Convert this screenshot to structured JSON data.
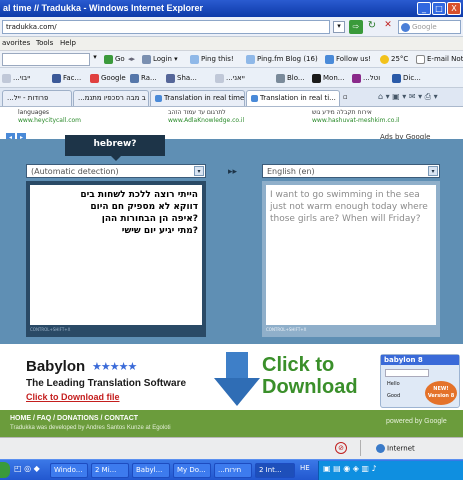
{
  "window": {
    "title": "al time // Tradukka - Windows Internet Explorer",
    "min": "_",
    "max": "□",
    "close": "X"
  },
  "address": {
    "url": "tradukka.com/",
    "search_placeholder": "Google"
  },
  "menu": [
    "avorites",
    "Tools",
    "Help"
  ],
  "google_toolbar": {
    "go": "Go",
    "login": "Login",
    "ping_this": "Ping this!",
    "ping_blog": "Ping.fm Blog (16)",
    "follow": "Follow us!",
    "weather": "25°C",
    "email": "E-mail Notifier"
  },
  "favorites": [
    "...ייבוי",
    "Fac...",
    "Google",
    "Ra...",
    "Sha...",
    "...ייאני",
    "Blo...",
    "Mon...",
    "...וטל",
    "Dic..."
  ],
  "tabs": [
    "...פרודות - ייל",
    "...מעמים ב מבה רסכפיו מתנמ",
    "Translation in real time //...",
    "Translation in real ti..."
  ],
  "ads": [
    {
      "line": "languages",
      "url": "www.heycitycall.com"
    },
    {
      "line": "לתרגום עד עמוד הזהב",
      "url": "www.AdlaKnowledge.co.il"
    },
    {
      "line": "אירוח תקבלה מידע גוש",
      "url": "www.hashuvat-meshkim.co.il"
    }
  ],
  "ads_by": "Ads by Google",
  "translator": {
    "detected_label": "hebrew?",
    "source_lang": "(Automatic detection)",
    "target_lang": "English (en)",
    "source_lines": [
      "הייתי רוצה ללכת לשחות בים",
      "דווקא לא מספיק חם היום",
      "?איפה הן הבחורות ההן",
      "?מתי יגיע יום שישי"
    ],
    "target_text": "I want to go swimming in the sea just not warm enough today where those girls are? When will Friday?",
    "control_label": "CONTROL+SHIFT+X"
  },
  "babylon": {
    "name": "Babylon",
    "tagline": "The Leading Translation Software",
    "link": "Click to Download file",
    "cta_line1": "Click to",
    "cta_line2": "Download",
    "product": "babylon 8",
    "badge_line1": "NEW!",
    "badge_line2": "Version 8",
    "menu_items": [
      "Hello",
      "Good"
    ]
  },
  "footer": {
    "links": "HOME / FAQ / DONATIONS / CONTACT",
    "credit": "Tradukka was developed by Andres Santos Kunze at Egoloti",
    "powered": "powered by Google"
  },
  "statusbar": {
    "zone": "Internet"
  },
  "taskbar": {
    "items": [
      "Windo...",
      "2 Mi...",
      "Babyl...",
      "My Do...",
      "...חירוח",
      "2 Int...",
      "HE"
    ],
    "clock": ""
  },
  "colors": {
    "translator_bg": "#5f8fb4",
    "panel_bg": "#2a4a66",
    "footer_bg": "#6b9c3c",
    "babylon_green": "#3a8f2a",
    "babylon_red": "#c41e1e"
  }
}
